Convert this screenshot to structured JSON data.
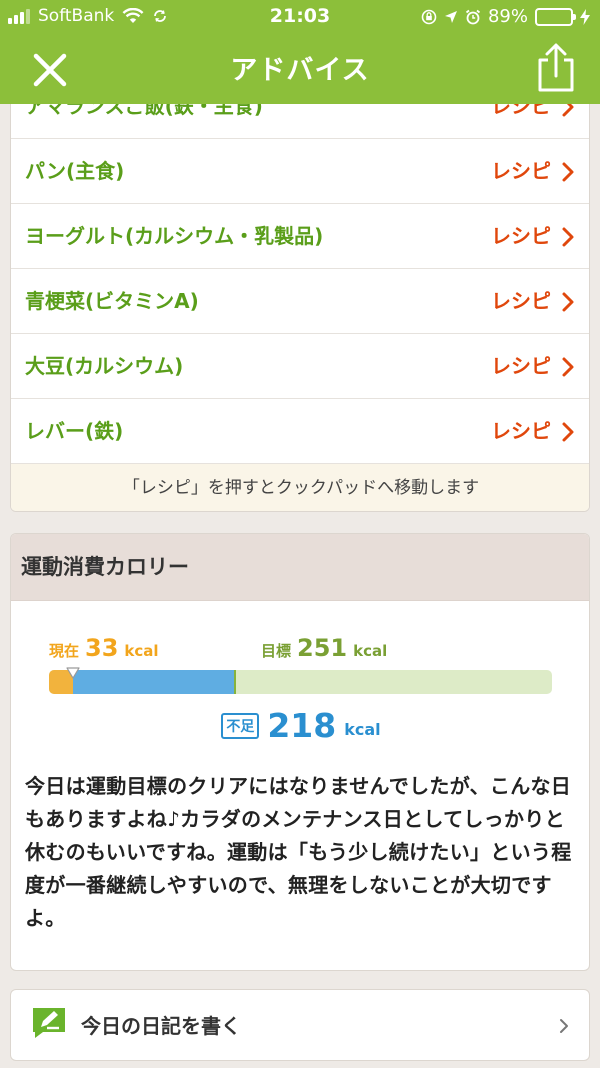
{
  "status_bar": {
    "carrier": "SoftBank",
    "time": "21:03",
    "battery_percent": "89%",
    "battery_level": 0.89,
    "icons": [
      "signal-icon",
      "wifi-icon",
      "sync-icon",
      "rotation-lock-icon",
      "location-icon",
      "alarm-icon",
      "battery-icon",
      "charging-icon"
    ]
  },
  "nav": {
    "title": "アドバイス",
    "close_icon": "close-icon",
    "share_icon": "share-icon"
  },
  "recipes": {
    "items": [
      {
        "name": "アマランスご飯(鉄・主食)",
        "link": "レシピ"
      },
      {
        "name": "パン(主食)",
        "link": "レシピ"
      },
      {
        "name": "ヨーグルト(カルシウム・乳製品)",
        "link": "レシピ"
      },
      {
        "name": "青梗菜(ビタミンA)",
        "link": "レシピ"
      },
      {
        "name": "大豆(カルシウム)",
        "link": "レシピ"
      },
      {
        "name": "レバー(鉄)",
        "link": "レシピ"
      }
    ],
    "note": "「レシピ」を押すとクックパッドへ移動します"
  },
  "exercise": {
    "title": "運動消費カロリー",
    "current_label": "現在",
    "current_value": "33",
    "goal_label": "目標",
    "goal_value": "251",
    "unit": "kcal",
    "shortage_label": "不足",
    "shortage_value": "218",
    "bar_scale_max": 680,
    "message": "今日は運動目標のクリアにはなりませんでしたが、こんな日もありますよね♪カラダのメンテナンス日としてしっかりと休むのもいいですね。運動は「もう少し続けたい」という程度が一番継続しやすいので、無理をしないことが大切ですよ。"
  },
  "diary": {
    "label": "今日の日記を書く",
    "icon": "pencil-note-icon"
  },
  "colors": {
    "brand_green": "#8cbf3a",
    "recipe_green": "#5a9e1a",
    "recipe_red": "#e0470c",
    "current_orange": "#f2b33d",
    "shortage_blue": "#5fade2"
  }
}
